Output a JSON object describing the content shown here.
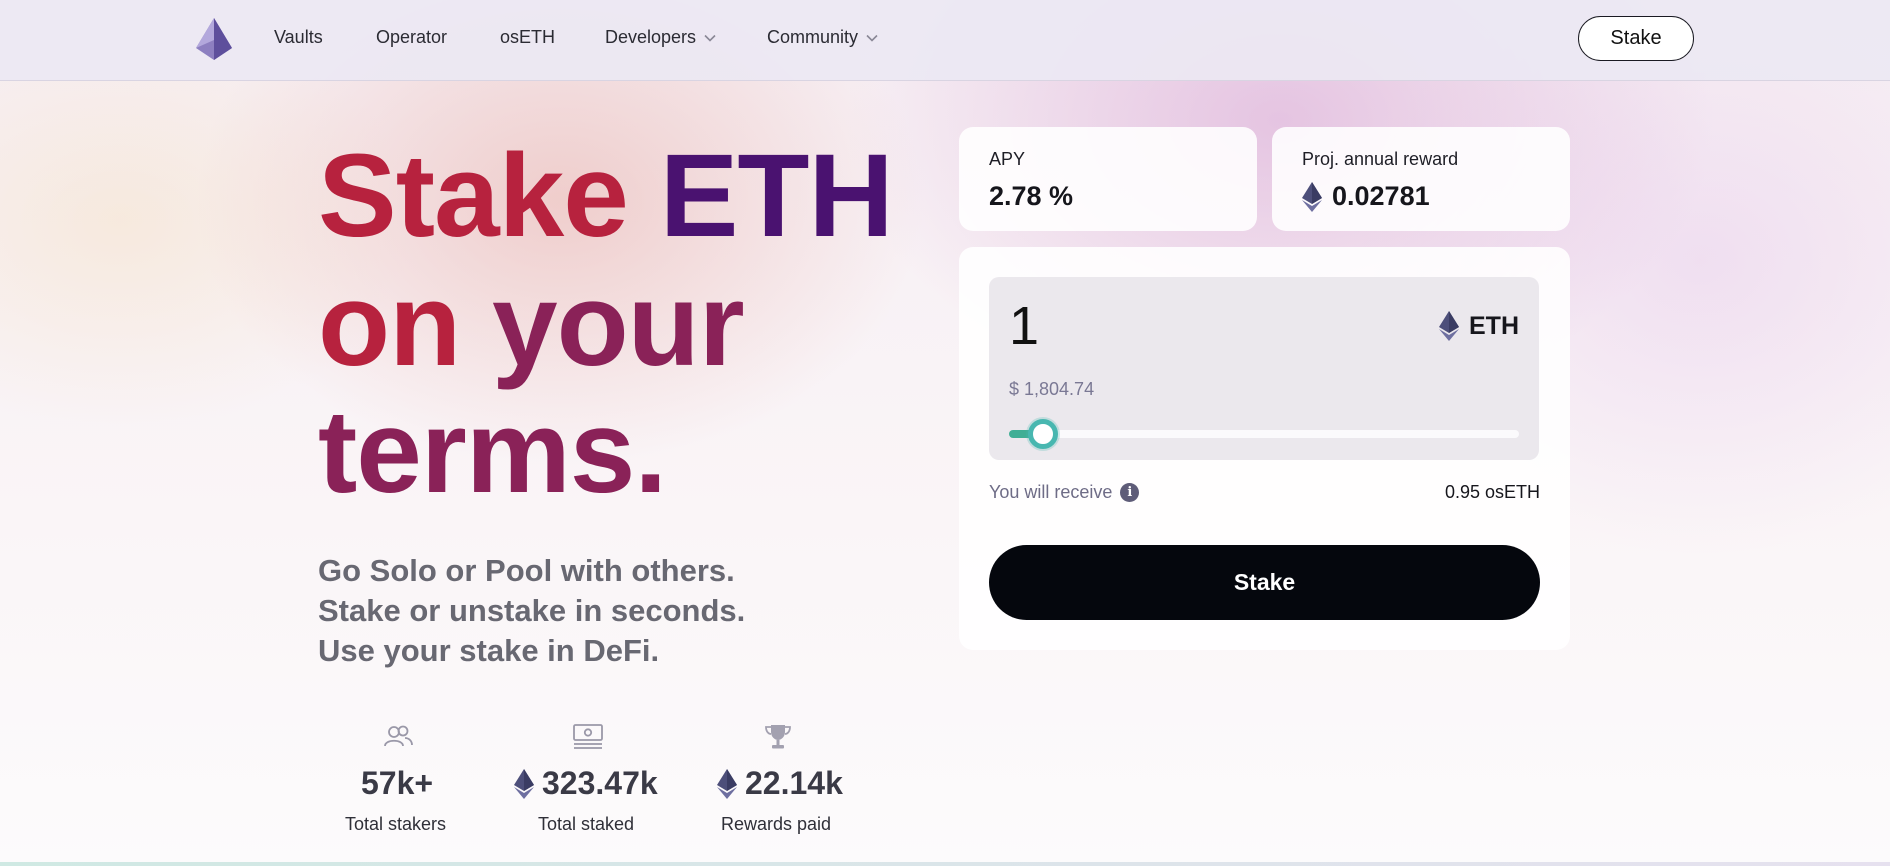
{
  "nav": {
    "items": [
      {
        "label": "Vaults"
      },
      {
        "label": "Operator"
      },
      {
        "label": "osETH"
      },
      {
        "label": "Developers",
        "dropdown": true
      },
      {
        "label": "Community",
        "dropdown": true
      }
    ],
    "stake_label": "Stake",
    "logo_icon": "ethereum-diamond-icon"
  },
  "hero": {
    "line1_a": "Stake",
    "line1_b": "ETH",
    "line2_a": "on",
    "line2_b": "your",
    "line3": "terms.",
    "subtitle": [
      "Go Solo or Pool with others.",
      "Stake or unstake in seconds.",
      "Use your stake in DeFi."
    ]
  },
  "stats": [
    {
      "icon": "users-icon",
      "value": "57k+",
      "label": "Total stakers",
      "eth": false
    },
    {
      "icon": "banknote-icon",
      "value": "323.47k",
      "label": "Total staked",
      "eth": true
    },
    {
      "icon": "trophy-icon",
      "value": "22.14k",
      "label": "Rewards paid",
      "eth": true
    }
  ],
  "apy": {
    "label": "APY",
    "value": "2.78 %"
  },
  "reward": {
    "label": "Proj. annual reward",
    "value": "0.02781"
  },
  "stake_form": {
    "amount": "1",
    "token": "ETH",
    "usd_value": "$ 1,804.74",
    "slider_fraction": 0.05,
    "receive_label": "You will receive",
    "receive_value": "0.95 osETH",
    "button_label": "Stake"
  },
  "colors": {
    "accent_red": "#b7223e",
    "accent_purple": "#4a1270",
    "slider": "#48b7b0",
    "button": "#05070d"
  }
}
